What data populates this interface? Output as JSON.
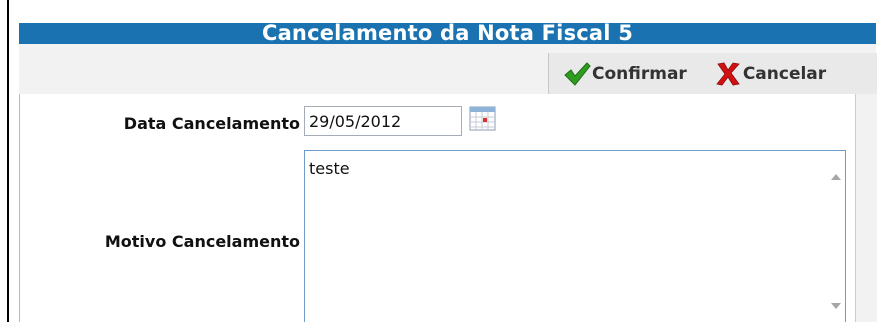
{
  "dialog": {
    "title": "Cancelamento da Nota Fiscal 5"
  },
  "toolbar": {
    "confirm_label": "Confirmar",
    "cancel_label": "Cancelar",
    "confirm_icon": "checkmark-icon",
    "cancel_icon": "x-mark-icon"
  },
  "form": {
    "date_label": "Data Cancelamento",
    "date_value": "29/05/2012",
    "calendar_icon": "calendar-icon",
    "reason_label": "Motivo Cancelamento",
    "reason_value": "teste"
  },
  "colors": {
    "title_bar": "#1a73b0",
    "confirm_icon": "#2e9c1f",
    "cancel_icon": "#d01212"
  }
}
